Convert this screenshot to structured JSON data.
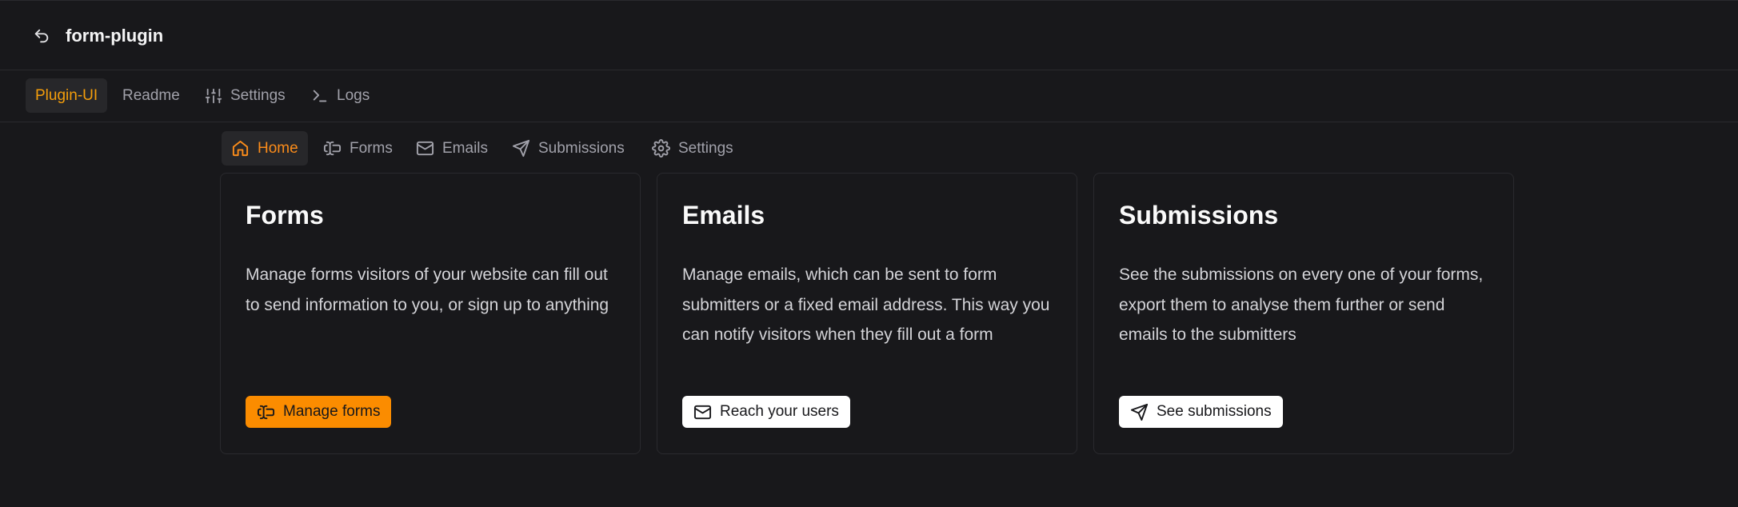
{
  "header": {
    "title": "form-plugin",
    "back_icon": "undo-arrow-icon"
  },
  "tabs": [
    {
      "label": "Plugin-UI",
      "active": true
    },
    {
      "label": "Readme",
      "active": false
    },
    {
      "label": "Settings",
      "icon": "sliders-icon",
      "active": false
    },
    {
      "label": "Logs",
      "icon": "terminal-icon",
      "active": false
    }
  ],
  "subnav": [
    {
      "label": "Home",
      "icon": "home-icon",
      "active": true
    },
    {
      "label": "Forms",
      "icon": "text-cursor-input-icon",
      "active": false
    },
    {
      "label": "Emails",
      "icon": "mail-icon",
      "active": false
    },
    {
      "label": "Submissions",
      "icon": "send-icon",
      "active": false
    },
    {
      "label": "Settings",
      "icon": "gear-icon",
      "active": false
    }
  ],
  "cards": [
    {
      "title": "Forms",
      "description": "Manage forms visitors of your website can fill out to send information to you, or sign up to anything",
      "button_label": "Manage forms",
      "button_icon": "text-cursor-input-icon"
    },
    {
      "title": "Emails",
      "description": "Manage emails, which can be sent to form submitters or a fixed email address. This way you can notify visitors when they fill out a form",
      "button_label": "Reach your users",
      "button_icon": "mail-icon"
    },
    {
      "title": "Submissions",
      "description": "See the submissions on every one of your forms, export them to analyse them further or send emails to the submitters",
      "button_label": "See submissions",
      "button_icon": "send-icon"
    }
  ],
  "colors": {
    "background": "#18181b",
    "accent": "#fb8c00",
    "border": "#2a2a2e",
    "muted_text": "#a1a1aa"
  }
}
